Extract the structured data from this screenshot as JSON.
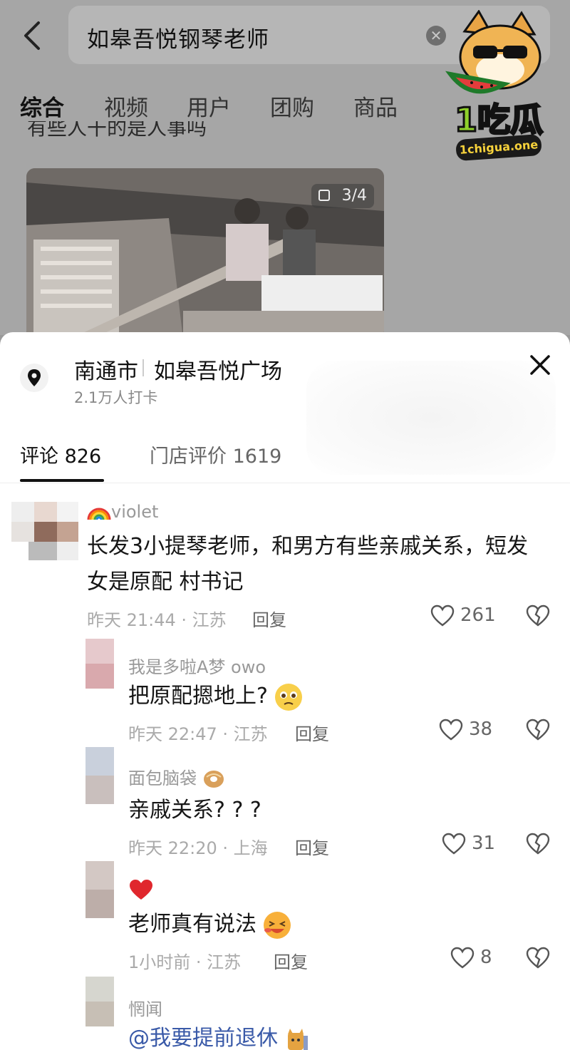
{
  "search": {
    "query": "如皋吾悦钢琴老师"
  },
  "tabs": [
    "综合",
    "视频",
    "用户",
    "团购",
    "商品"
  ],
  "feed": {
    "title_partial": "有些人干的是人事吗",
    "photo_counter": "3/4"
  },
  "logo": {
    "text": "1吃瓜",
    "domain": "1chigua.one"
  },
  "location": {
    "city": "南通市",
    "place": "如皋吾悦广场",
    "checkins": "2.1万人打卡"
  },
  "sheet_tabs": {
    "comments": "评论 826",
    "reviews": "门店评价 1619"
  },
  "comments": [
    {
      "user": "violet",
      "body_line1": "长发3小提琴老师，和男方有些亲戚关系，短发",
      "body_line2": "女是原配 村书记",
      "time": "昨天 21:44 · 江苏",
      "reply": "回复",
      "likes": "261"
    },
    {
      "user": "我是多啦A梦 owo",
      "body": "把原配摁地上?",
      "time": "昨天 22:47 · 江苏",
      "reply": "回复",
      "likes": "38"
    },
    {
      "user": "面包脑袋",
      "body": "亲戚关系? ? ?",
      "time": "昨天 22:20 · 上海",
      "reply": "回复",
      "likes": "31"
    },
    {
      "user": "",
      "body": "老师真有说法",
      "time": "1小时前 · 江苏",
      "reply": "回复",
      "likes": "8"
    },
    {
      "user": "惘闻",
      "body": "@我要提前退休"
    }
  ],
  "colors": {
    "sheet_bg": "#ffffff",
    "dim_bg": "#a6a6a6",
    "mention": "#3a5aa8"
  }
}
